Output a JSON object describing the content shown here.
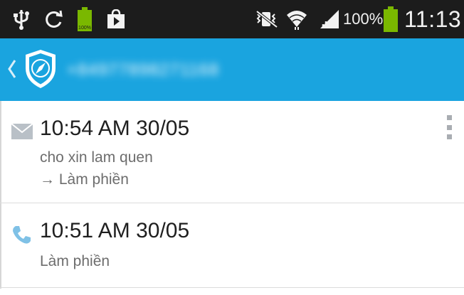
{
  "status_bar": {
    "battery_percent": "100%",
    "time": "11:13",
    "icons": [
      "usb-icon",
      "sync-icon",
      "battery-charging-icon",
      "play-store-icon",
      "silent-mode-icon",
      "wifi-icon",
      "signal-icon",
      "battery-icon"
    ]
  },
  "action_bar": {
    "title": "+84977898271168",
    "logo": "shield-compass-icon",
    "color": "#1aa4df"
  },
  "log": [
    {
      "type": "sms",
      "icon": "envelope-icon",
      "time": "10:54 AM 30/05",
      "content": "cho xin lam quen",
      "result": "→ Làm phiền"
    },
    {
      "type": "call",
      "icon": "phone-icon",
      "time": "10:51 AM 30/05",
      "result": "Làm phiền"
    }
  ]
}
